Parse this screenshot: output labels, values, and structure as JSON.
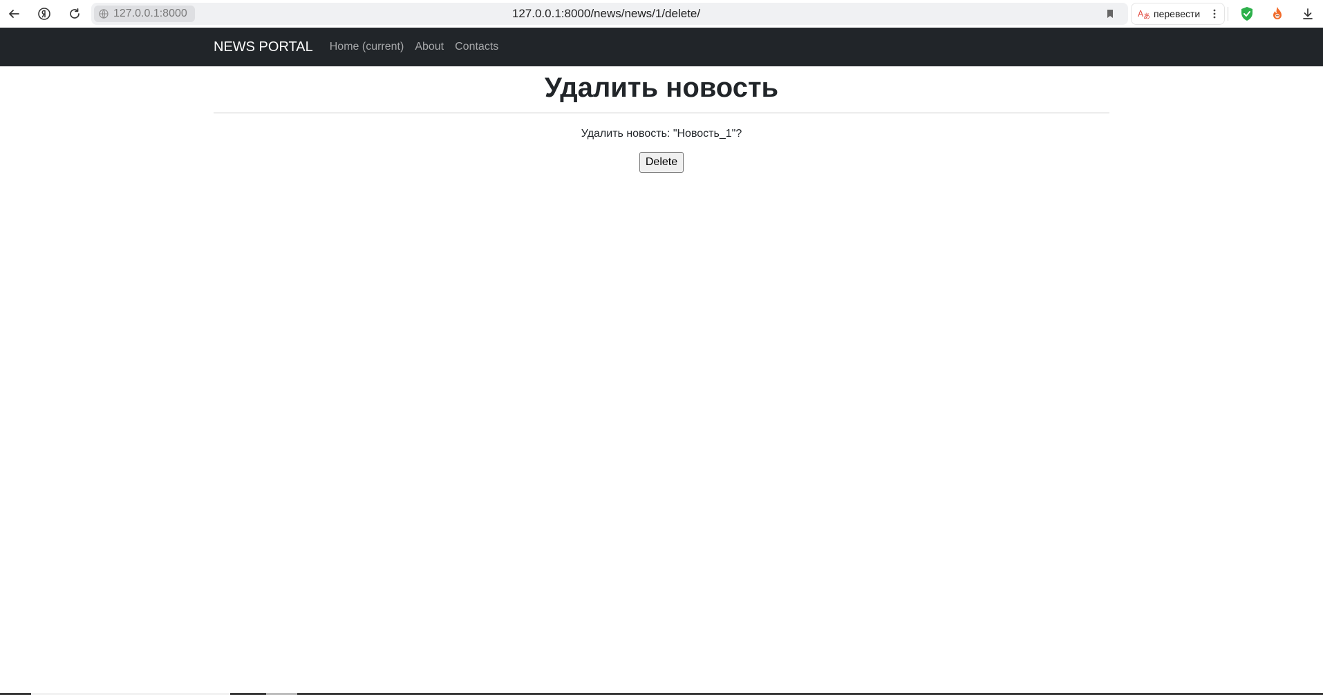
{
  "browser": {
    "origin": "127.0.0.1:8000",
    "url": "127.0.0.1:8000/news/news/1/delete/",
    "translate_label": "перевести",
    "icons": {
      "back": "arrow-left-icon",
      "yandex": "yandex-icon",
      "reload": "reload-icon",
      "site_info": "globe-icon",
      "bookmark": "bookmark-icon",
      "translate": "translate-icon",
      "menu": "more-vertical-icon",
      "protect": "shield-check-icon",
      "extension": "fire-extension-icon",
      "download": "download-icon"
    }
  },
  "navbar": {
    "brand": "NEWS PORTAL",
    "links": [
      {
        "label": "Home (current)"
      },
      {
        "label": "About"
      },
      {
        "label": "Contacts"
      }
    ],
    "bg_color": "#212529"
  },
  "main": {
    "title": "Удалить новость",
    "confirm_text": "Удалить новость: \"Новость_1\"?",
    "delete_label": "Delete"
  }
}
